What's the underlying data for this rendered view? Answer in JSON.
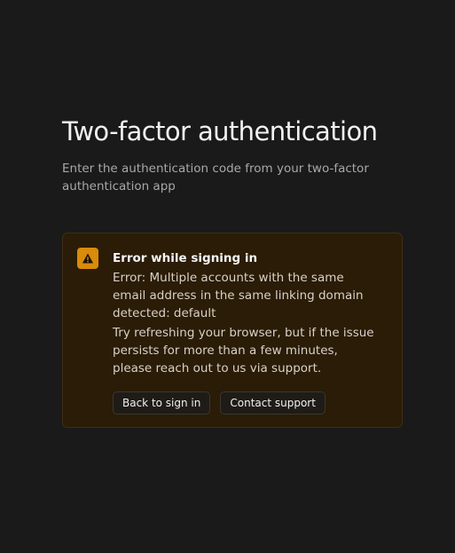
{
  "header": {
    "title": "Two-factor authentication",
    "subtitle": "Enter the authentication code from your two-factor authentication app"
  },
  "alert": {
    "icon": "warning-icon",
    "accent_color": "#d98b0a",
    "background_color": "#2a1c06",
    "heading": "Error while signing in",
    "message": "Error: Multiple accounts with the same email address in the same linking domain detected: default",
    "hint": "Try refreshing your browser, but if the issue persists for more than a few minutes, please reach out to us via support.",
    "actions": {
      "back_label": "Back to sign in",
      "support_label": "Contact support"
    }
  }
}
